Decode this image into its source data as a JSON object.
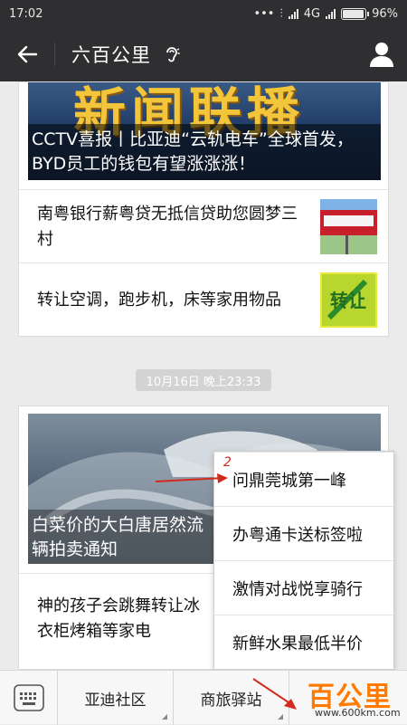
{
  "status": {
    "time": "17:02",
    "network": "4G",
    "battery": "96%",
    "battery_level": 0.96
  },
  "header": {
    "title": "六百公里"
  },
  "card1": {
    "hero_caption": "CCTV喜报丨比亚迪“云轨电车”全球首发，BYD员工的钱包有望涨涨涨！",
    "items": [
      {
        "text": "南粤银行薪粤贷无抵信贷助您圆梦三村"
      },
      {
        "text": "转让空调，跑步机，床等家用物品",
        "thumb_text": "转让"
      }
    ]
  },
  "timestamp": "10月16日 晚上23:33",
  "card2": {
    "hero_caption": "白菜价的大白唐居然流……辆拍卖通知",
    "hero_caption_line1": "白菜价的大白唐居然流",
    "hero_caption_line2": "辆拍卖通知",
    "item_line1": "神的孩子会跳舞转让冰",
    "item_line2": "衣柜烤箱等家电"
  },
  "popup": {
    "marker": "2",
    "items": [
      "问鼎莞城第一峰",
      "办粤通卡送标签啦",
      "激情对战悦享骑行",
      "新鲜水果最低半价"
    ]
  },
  "bottom_bar": {
    "tabs": [
      "亚迪社区",
      "商旅驿站",
      ""
    ]
  },
  "watermark": {
    "logo": "百公里",
    "url": "www.600km.com"
  },
  "colors": {
    "bar_bg": "#2f2f31",
    "accent_red": "#d12a1f",
    "watermark_orange": "#ff7a00"
  }
}
